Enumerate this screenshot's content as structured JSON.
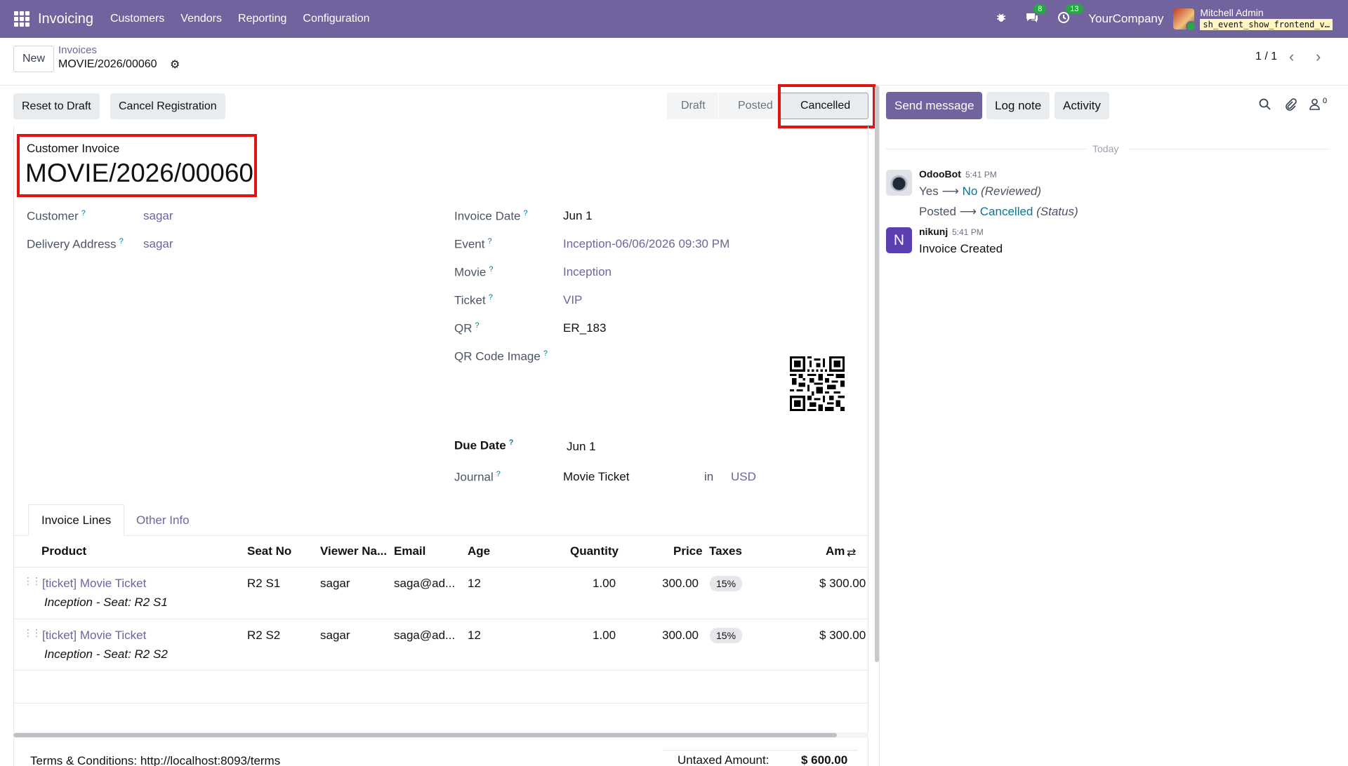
{
  "navbar": {
    "app_name": "Invoicing",
    "menu": [
      "Customers",
      "Vendors",
      "Reporting",
      "Configuration"
    ],
    "messages_count": "8",
    "activities_count": "13",
    "company": "YourCompany",
    "user_name": "Mitchell Admin",
    "db_name": "sh_event_show_frontend_v…",
    "icons": [
      "apps-grid-icon",
      "bug-icon",
      "chat-icon",
      "clock-icon"
    ],
    "color": "#71639e"
  },
  "control_panel": {
    "new_label": "New",
    "breadcrumb_parent": "Invoices",
    "breadcrumb_current": "MOVIE/2026/00060",
    "pager": "1 / 1"
  },
  "actions": {
    "reset_to_draft": "Reset to Draft",
    "cancel_registration": "Cancel Registration"
  },
  "status_stages": {
    "draft": "Draft",
    "posted": "Posted",
    "cancelled": "Cancelled",
    "current": "Cancelled"
  },
  "form": {
    "doc_type": "Customer Invoice",
    "title": "MOVIE/2026/00060",
    "customer_label": "Customer",
    "customer": "sagar",
    "delivery_label": "Delivery Address",
    "delivery": "sagar",
    "invoice_date_label": "Invoice Date",
    "invoice_date": "Jun 1",
    "event_label": "Event",
    "event": "Inception-06/06/2026 09:30 PM",
    "movie_label": "Movie",
    "movie": "Inception",
    "ticket_label": "Ticket",
    "ticket": "VIP",
    "qr_label": "QR",
    "qr": "ER_183",
    "qr_image_label": "QR Code Image",
    "due_date_label": "Due Date",
    "due_date": "Jun 1",
    "journal_label": "Journal",
    "journal": "Movie Ticket",
    "in_label": "in",
    "currency": "USD",
    "help_mark": "?"
  },
  "tabs": {
    "invoice_lines": "Invoice Lines",
    "other_info": "Other Info"
  },
  "table": {
    "headers": {
      "product": "Product",
      "seat_no": "Seat No",
      "viewer": "Viewer Na...",
      "email": "Email",
      "age": "Age",
      "quantity": "Quantity",
      "price": "Price",
      "taxes": "Taxes",
      "amount": "Am"
    },
    "rows": [
      {
        "product": "[ticket] Movie Ticket",
        "note": "Inception - Seat: R2 S1",
        "seat": "R2 S1",
        "viewer": "sagar",
        "email": "saga@ad...",
        "age": "12",
        "quantity": "1.00",
        "price": "300.00",
        "tax": "15%",
        "amount": "$ 300.00"
      },
      {
        "product": "[ticket] Movie Ticket",
        "note": "Inception - Seat: R2 S2",
        "seat": "R2 S2",
        "viewer": "sagar",
        "email": "saga@ad...",
        "age": "12",
        "quantity": "1.00",
        "price": "300.00",
        "tax": "15%",
        "amount": "$ 300.00"
      }
    ]
  },
  "footer": {
    "terms": "Terms & Conditions: http://localhost:8093/terms",
    "untaxed_label": "Untaxed Amount:",
    "untaxed_value": "$ 600.00"
  },
  "chatter": {
    "send_message": "Send message",
    "log_note": "Log note",
    "activity": "Activity",
    "followers_count": "0",
    "date_separator": "Today",
    "messages": [
      {
        "author": "OdooBot",
        "time": "5:41 PM",
        "changes": [
          {
            "old": "Yes",
            "new": "No",
            "field": "(Reviewed)"
          },
          {
            "old": "Posted",
            "new": "Cancelled",
            "field": "(Status)"
          }
        ]
      },
      {
        "author": "nikunj",
        "avatar_letter": "N",
        "time": "5:41 PM",
        "body": "Invoice Created"
      }
    ]
  },
  "colors": {
    "brand": "#71639e",
    "highlight": "#e11414",
    "link_teal": "#0e7490",
    "badge_green": "#28a745"
  }
}
